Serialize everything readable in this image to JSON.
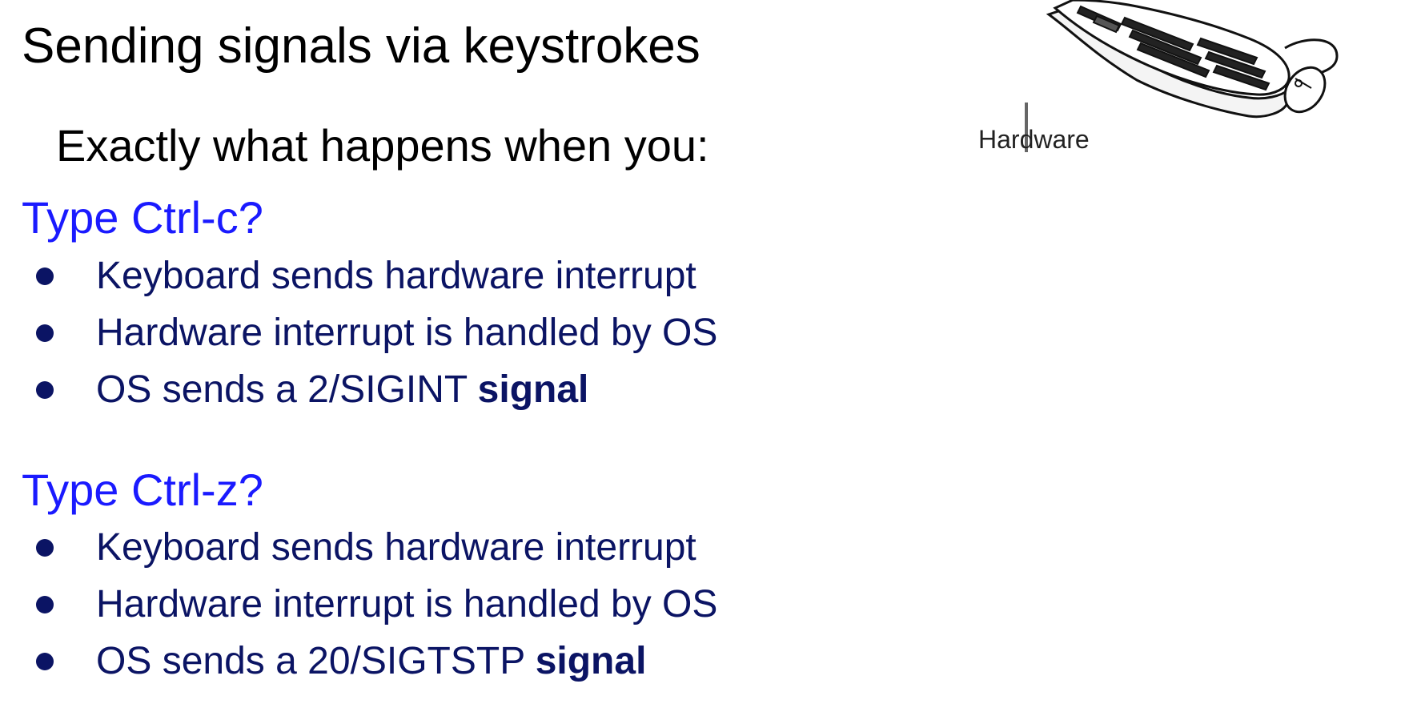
{
  "slide": {
    "title": "Sending signals via keystrokes",
    "subtitle": "Exactly what happens when you:"
  },
  "sections": [
    {
      "heading": "Type Ctrl-c?",
      "bullets": [
        {
          "text": "Keyboard sends hardware interrupt",
          "bold": ""
        },
        {
          "text": "Hardware interrupt is handled by OS",
          "bold": ""
        },
        {
          "text": "OS sends a 2/SIGINT ",
          "bold": "signal"
        }
      ]
    },
    {
      "heading": "Type Ctrl-z?",
      "bullets": [
        {
          "text": "Keyboard sends hardware interrupt",
          "bold": ""
        },
        {
          "text": "Hardware interrupt is handled by OS",
          "bold": ""
        },
        {
          "text": "OS sends a 20/SIGTSTP ",
          "bold": "signal"
        }
      ]
    }
  ],
  "illustration": {
    "label": "Hardware",
    "icon": "keyboard-mouse-icon"
  },
  "colors": {
    "heading": "#1a1aff",
    "bullet_text": "#0b1464",
    "title": "#000000"
  }
}
